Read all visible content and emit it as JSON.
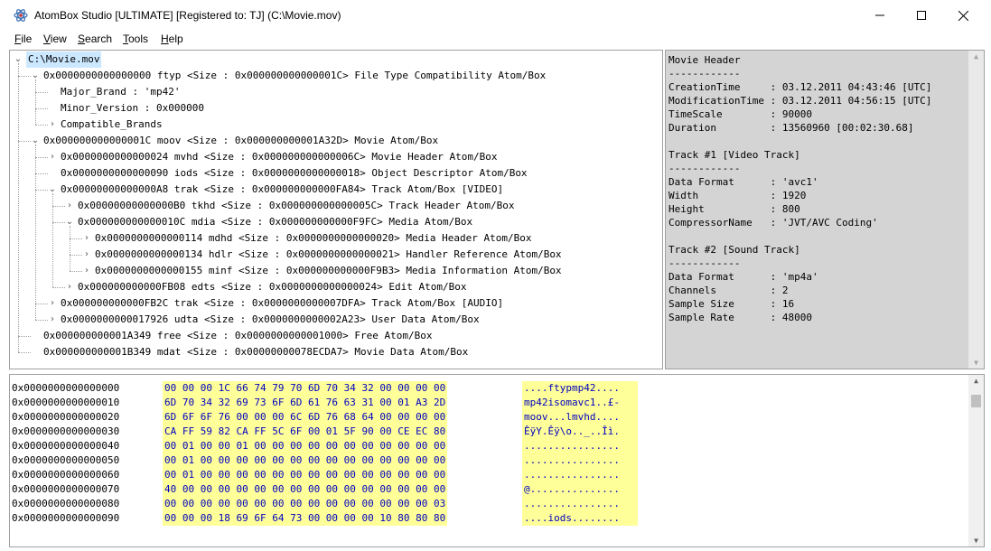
{
  "window": {
    "title": "AtomBox Studio [ULTIMATE] [Registered to: TJ] (C:\\Movie.mov)",
    "minimize_glyph": "—",
    "maximize_glyph": "☐",
    "close_glyph": "✕"
  },
  "menu": [
    {
      "key": "F",
      "rest": "ile"
    },
    {
      "key": "V",
      "rest": "iew"
    },
    {
      "key": "S",
      "rest": "earch"
    },
    {
      "key": "T",
      "rest": "ools"
    },
    {
      "key": "H",
      "rest": "elp"
    }
  ],
  "tree": [
    {
      "level": 0,
      "expander": "v",
      "text": "C:\\Movie.mov",
      "selected": true
    },
    {
      "level": 1,
      "expander": "v",
      "text": "0x0000000000000000 ftyp <Size : 0x000000000000001C> File Type Compatibility Atom/Box"
    },
    {
      "level": 2,
      "expander": "",
      "text": "Major_Brand                 : 'mp42'"
    },
    {
      "level": 2,
      "expander": "",
      "text": "Minor_Version               : 0x000000"
    },
    {
      "level": 2,
      "expander": ">",
      "text": "Compatible_Brands"
    },
    {
      "level": 1,
      "expander": "v",
      "text": "0x000000000000001C moov <Size : 0x000000000001A32D> Movie Atom/Box"
    },
    {
      "level": 2,
      "expander": ">",
      "text": "0x0000000000000024 mvhd <Size : 0x000000000000006C> Movie Header Atom/Box"
    },
    {
      "level": 2,
      "expander": "",
      "text": "0x0000000000000090 iods <Size : 0x0000000000000018> Object Descriptor Atom/Box"
    },
    {
      "level": 2,
      "expander": "v",
      "text": "0x00000000000000A8 trak <Size : 0x000000000000FA84> Track Atom/Box [VIDEO]"
    },
    {
      "level": 3,
      "expander": ">",
      "text": "0x00000000000000B0 tkhd <Size : 0x000000000000005C> Track Header Atom/Box"
    },
    {
      "level": 3,
      "expander": "v",
      "text": "0x000000000000010C mdia <Size : 0x000000000000F9FC> Media Atom/Box"
    },
    {
      "level": 4,
      "expander": ">",
      "text": "0x0000000000000114 mdhd <Size : 0x0000000000000020> Media Header Atom/Box"
    },
    {
      "level": 4,
      "expander": ">",
      "text": "0x0000000000000134 hdlr <Size : 0x0000000000000021> Handler Reference Atom/Box"
    },
    {
      "level": 4,
      "expander": ">",
      "text": "0x0000000000000155 minf <Size : 0x000000000000F9B3> Media Information Atom/Box"
    },
    {
      "level": 3,
      "expander": ">",
      "text": "0x000000000000FB08 edts <Size : 0x0000000000000024> Edit Atom/Box"
    },
    {
      "level": 2,
      "expander": ">",
      "text": "0x000000000000FB2C trak <Size : 0x0000000000007DFA> Track Atom/Box [AUDIO]"
    },
    {
      "level": 2,
      "expander": ">",
      "text": "0x0000000000017926 udta <Size : 0x0000000000002A23> User Data Atom/Box"
    },
    {
      "level": 1,
      "expander": "",
      "text": "0x000000000001A349 free <Size : 0x0000000000001000> Free Atom/Box"
    },
    {
      "level": 1,
      "expander": "",
      "text": "0x000000000001B349 mdat <Size : 0x00000000078ECDA7> Movie Data Atom/Box"
    }
  ],
  "info_panel": [
    "Movie Header",
    "------------",
    "CreationTime     : 03.12.2011 04:43:46 [UTC]",
    "ModificationTime : 03.12.2011 04:56:15 [UTC]",
    "TimeScale        : 90000",
    "Duration         : 13560960 [00:02:30.68]",
    "",
    "Track #1 [Video Track]",
    "------------",
    "Data Format      : 'avc1'",
    "Width            : 1920",
    "Height           : 800",
    "CompressorName   : 'JVT/AVC Coding'",
    "",
    "Track #2 [Sound Track]",
    "------------",
    "Data Format      : 'mp4a'",
    "Channels         : 2",
    "Sample Size      : 16",
    "Sample Rate      : 48000"
  ],
  "hex_rows": [
    {
      "offset": "0x0000000000000000",
      "bytes": "00 00 00 1C 66 74 79 70 6D 70 34 32 00 00 00 00",
      "ascii": "....ftypmp42...."
    },
    {
      "offset": "0x0000000000000010",
      "bytes": "6D 70 34 32 69 73 6F 6D 61 76 63 31 00 01 A3 2D",
      "ascii": "mp42isomavc1..£-"
    },
    {
      "offset": "0x0000000000000020",
      "bytes": "6D 6F 6F 76 00 00 00 6C 6D 76 68 64 00 00 00 00",
      "ascii": "moov...lmvhd...."
    },
    {
      "offset": "0x0000000000000030",
      "bytes": "CA FF 59 82 CA FF 5C 6F 00 01 5F 90 00 CE EC 80",
      "ascii": "ÊÿY.Êÿ\\o.._..Îì."
    },
    {
      "offset": "0x0000000000000040",
      "bytes": "00 01 00 00 01 00 00 00 00 00 00 00 00 00 00 00",
      "ascii": "................"
    },
    {
      "offset": "0x0000000000000050",
      "bytes": "00 01 00 00 00 00 00 00 00 00 00 00 00 00 00 00",
      "ascii": "................"
    },
    {
      "offset": "0x0000000000000060",
      "bytes": "00 01 00 00 00 00 00 00 00 00 00 00 00 00 00 00",
      "ascii": "................"
    },
    {
      "offset": "0x0000000000000070",
      "bytes": "40 00 00 00 00 00 00 00 00 00 00 00 00 00 00 00",
      "ascii": "@..............."
    },
    {
      "offset": "0x0000000000000080",
      "bytes": "00 00 00 00 00 00 00 00 00 00 00 00 00 00 00 03",
      "ascii": "................"
    },
    {
      "offset": "0x0000000000000090",
      "bytes": "00 00 00 18 69 6F 64 73 00 00 00 00 10 80 80 80",
      "ascii": "....iods........"
    }
  ],
  "colors": {
    "selection": "#cce8ff",
    "hex_highlight": "#ffff99",
    "hex_text": "#0000c0",
    "info_background": "#d4d4d4"
  },
  "icons": {
    "app": "atom-icon",
    "scroll_up": "▲",
    "scroll_down": "▼"
  }
}
